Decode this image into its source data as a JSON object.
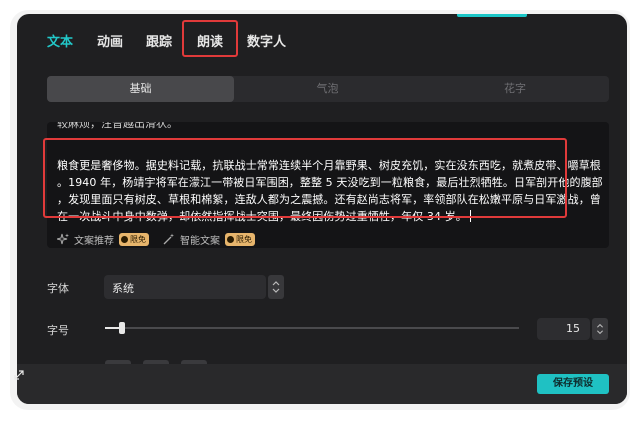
{
  "tabs": [
    {
      "label": "文本",
      "active": true
    },
    {
      "label": "动画",
      "active": false
    },
    {
      "label": "跟踪",
      "active": false
    },
    {
      "label": "朗读",
      "active": false,
      "highlighted": true
    },
    {
      "label": "数字人",
      "active": false
    }
  ],
  "subtabs": [
    {
      "label": "基础",
      "active": true
    },
    {
      "label": "气泡",
      "active": false
    },
    {
      "label": "花字",
      "active": false
    }
  ],
  "editor": {
    "previous_line": "较麻烦，注音越出滑状。",
    "lines": [
      "粮食更是奢侈物。据史料记载，抗联战士常常连续半个月靠野果、树皮充饥，实在没东西吃，就煮皮带、嚼草根",
      "。1940 年，杨靖宇将军在濛江一带被日军围困，整整 5 天没吃到一粒粮食，最后壮烈牺牲。日军剖开他的腹部",
      "，发现里面只有树皮、草根和棉絮，连敌人都为之震撼。还有赵尚志将军，率领部队在松嫩平原与日军激战，曾",
      "在一次战斗中身中数弹，却依然指挥战士突围，最终因伤势过重牺牲，年仅 34 岁。"
    ],
    "ai_tools": [
      {
        "label": "文案推荐",
        "badge": "限免",
        "icon": "sparkle-icon"
      },
      {
        "label": "智能文案",
        "badge": "限免",
        "icon": "magic-wand-icon"
      }
    ]
  },
  "font": {
    "label": "字体",
    "value": "系统"
  },
  "size": {
    "label": "字号",
    "value": "15",
    "slider_fraction": 0.04
  },
  "footer": {
    "save_label": "保存预设"
  },
  "colors": {
    "accent": "#1fc1c3",
    "highlight": "#e03a3a",
    "panel": "#1f1f21"
  }
}
